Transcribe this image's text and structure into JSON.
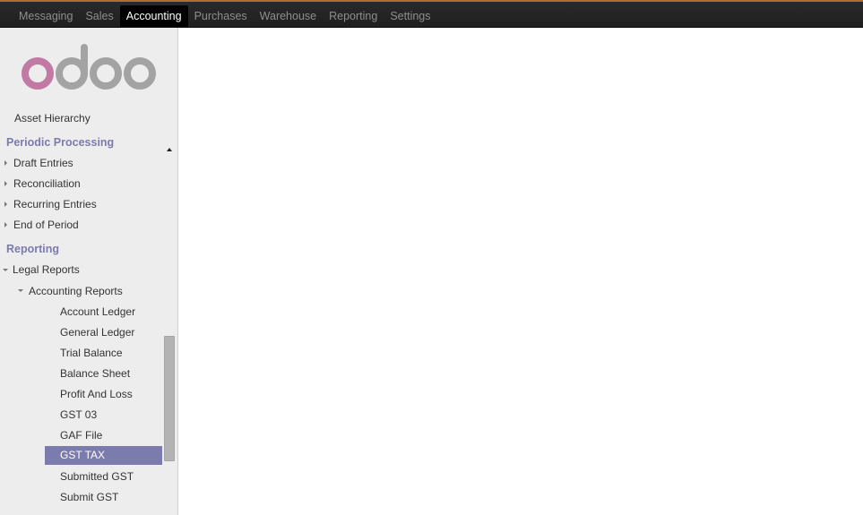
{
  "top_menu": [
    {
      "label": "Messaging",
      "active": false
    },
    {
      "label": "Sales",
      "active": false
    },
    {
      "label": "Accounting",
      "active": true
    },
    {
      "label": "Purchases",
      "active": false
    },
    {
      "label": "Warehouse",
      "active": false
    },
    {
      "label": "Reporting",
      "active": false
    },
    {
      "label": "Settings",
      "active": false
    }
  ],
  "logo": {
    "text": "odoo"
  },
  "sidebar": {
    "asset_hierarchy": "Asset Hierarchy",
    "periodic_processing": {
      "title": "Periodic Processing",
      "items": [
        "Draft Entries",
        "Reconciliation",
        "Recurring Entries",
        "End of Period"
      ]
    },
    "reporting": {
      "title": "Reporting",
      "legal_reports": "Legal Reports",
      "accounting_reports": "Accounting Reports",
      "leaves": [
        "Account Ledger",
        "General Ledger",
        "Trial Balance",
        "Balance Sheet",
        "Profit And Loss",
        "GST 03",
        "GAF File",
        "GST TAX",
        "Submitted GST",
        "Submit GST"
      ],
      "selected": "GST TAX"
    }
  },
  "colors": {
    "accent": "#7c7bad",
    "topbar": "#222222",
    "sidebar_bg": "#ededed"
  }
}
